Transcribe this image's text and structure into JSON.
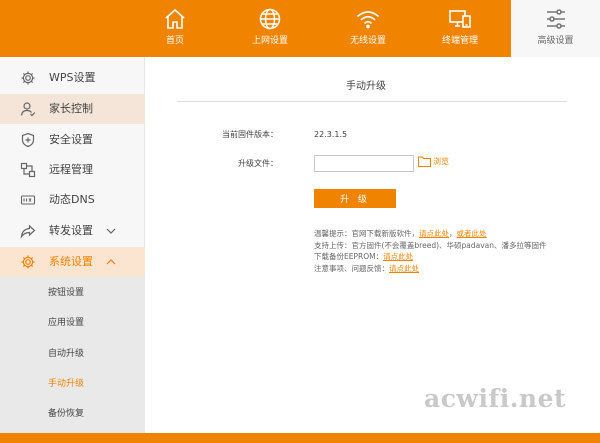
{
  "topnav": {
    "items": [
      {
        "label": "首页",
        "icon": "home-icon"
      },
      {
        "label": "上网设置",
        "icon": "globe-icon"
      },
      {
        "label": "无线设置",
        "icon": "wifi-icon"
      },
      {
        "label": "终端管理",
        "icon": "devices-icon"
      },
      {
        "label": "高级设置",
        "icon": "sliders-icon",
        "active": true
      }
    ]
  },
  "sidebar": {
    "items": [
      {
        "label": "WPS设置",
        "icon": "gear-icon"
      },
      {
        "label": "家长控制",
        "icon": "user-icon"
      },
      {
        "label": "安全设置",
        "icon": "shield-icon"
      },
      {
        "label": "远程管理",
        "icon": "remote-icon"
      },
      {
        "label": "动态DNS",
        "icon": "dns-icon"
      },
      {
        "label": "转发设置",
        "icon": "share-icon"
      },
      {
        "label": "系统设置",
        "icon": "gear-icon"
      }
    ],
    "submenu": [
      {
        "label": "按钮设置"
      },
      {
        "label": "应用设置"
      },
      {
        "label": "自动升级"
      },
      {
        "label": "手动升级",
        "current": true
      },
      {
        "label": "备份恢复"
      }
    ]
  },
  "main": {
    "title": "手动升级",
    "version_label": "当前固件版本：",
    "version_value": "22.3.1.5",
    "file_label": "升级文件：",
    "file_value": "",
    "browse_label": "浏览",
    "upgrade_label": "升 级",
    "notes": {
      "line1_prefix": "温馨提示：官网下载新版软件，",
      "line1_link1": "请点此处",
      "line1_sep": "，",
      "line1_link2": "或者此处",
      "line2": "支持上传：官方固件(不会覆盖breed)、华硕padavan、潘多拉等固件",
      "line3_prefix": "下载备份EEPROM：",
      "line3_link": "请点此处",
      "line4_prefix": "注意事项、问题反馈：",
      "line4_link": "请点此处"
    }
  },
  "watermark": "acwifi.net",
  "colors": {
    "accent": "#f08300",
    "sidebar_bg": "#f7f7f7",
    "submenu_bg": "#e9e9e9"
  }
}
